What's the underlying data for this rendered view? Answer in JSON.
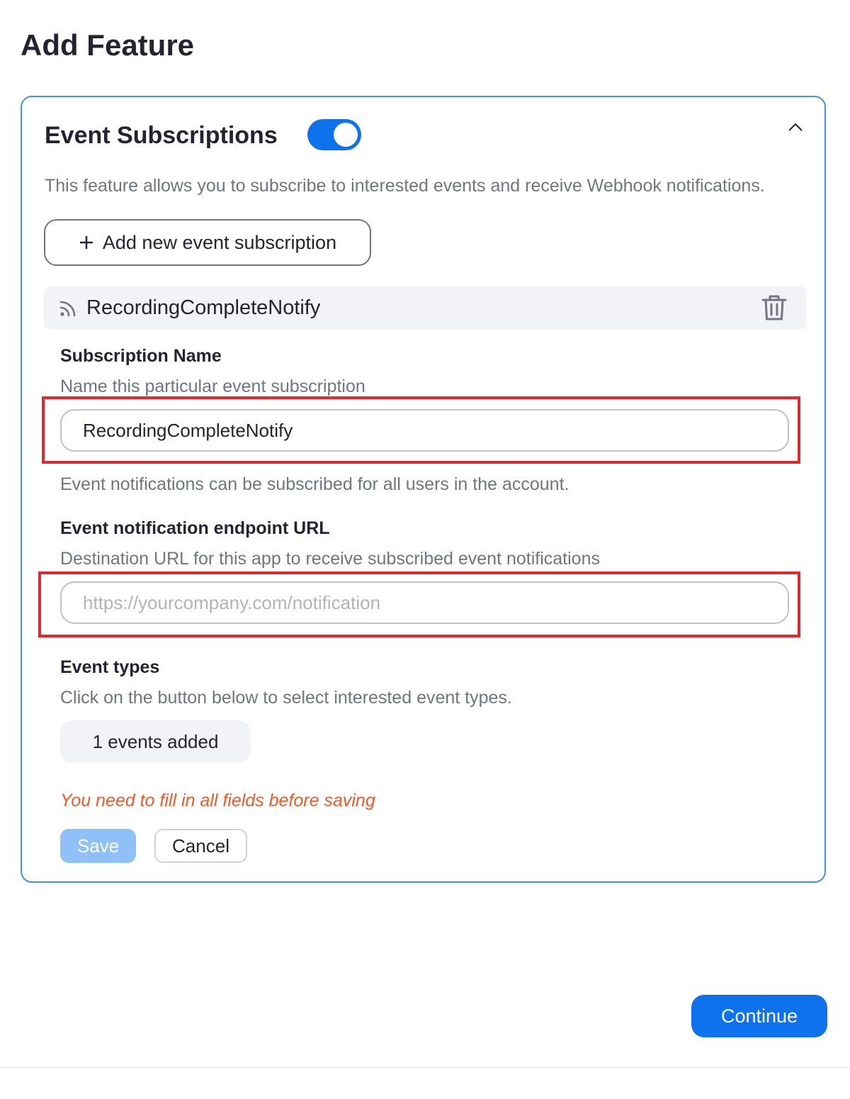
{
  "page": {
    "title": "Add Feature"
  },
  "feature": {
    "title": "Event Subscriptions",
    "enabled": true,
    "description": "This feature allows you to subscribe to interested events and receive Webhook notifications.",
    "add_button_label": "Add new event subscription"
  },
  "subscription": {
    "header_title": "RecordingCompleteNotify",
    "name_label": "Subscription Name",
    "name_help": "Name this particular event subscription",
    "name_value": "RecordingCompleteNotify",
    "scope_note": "Event notifications can be subscribed for all users in the account.",
    "url_label": "Event notification endpoint URL",
    "url_help": "Destination URL for this app to receive subscribed event notifications",
    "url_value": "",
    "url_placeholder": "https://yourcompany.com/notification",
    "event_types_label": "Event types",
    "event_types_help": "Click on the button below to select interested event types.",
    "events_button_label": "1 events added",
    "error_message": "You need to fill in all fields before saving",
    "save_label": "Save",
    "cancel_label": "Cancel"
  },
  "footer": {
    "continue_label": "Continue"
  },
  "colors": {
    "accent": "#0e72ed",
    "highlight": "#e02831",
    "error": "#f05a28",
    "card_border": "#4a90e2"
  },
  "icons": [
    "plus-icon",
    "chevron-up-icon",
    "rss-icon",
    "trash-icon"
  ]
}
